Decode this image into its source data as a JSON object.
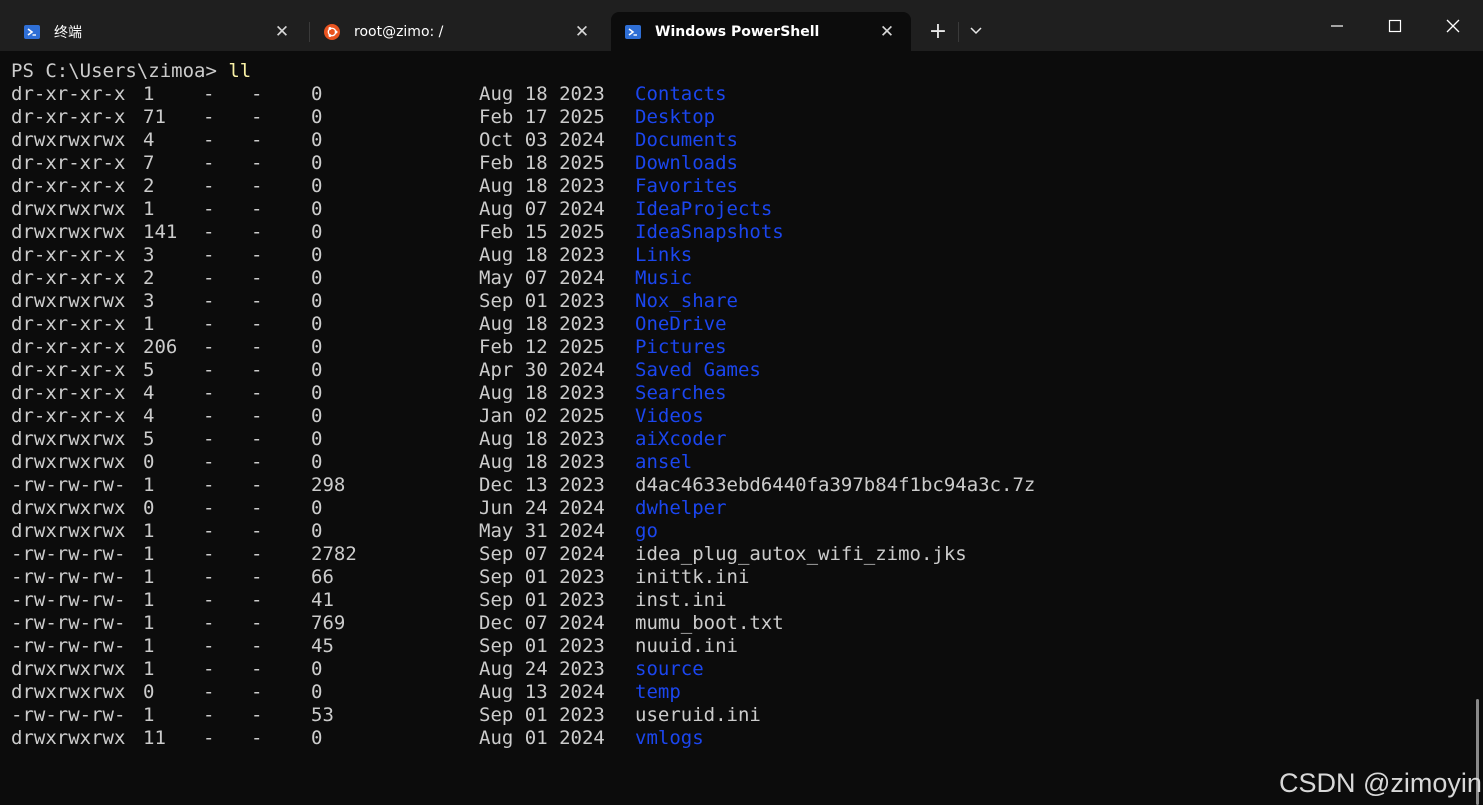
{
  "tabs": [
    {
      "title": "终端",
      "icon": "powershell-icon",
      "active": false
    },
    {
      "title": "root@zimo: /",
      "icon": "ubuntu-icon",
      "active": false
    },
    {
      "title": "Windows PowerShell",
      "icon": "powershell-icon",
      "active": true
    }
  ],
  "colors": {
    "background": "#0c0c0c",
    "titlebar": "#1f1f1f",
    "text": "#cccccc",
    "command": "#f9f1a5",
    "directory": "#1b46ef",
    "powershell_blue": "#2f6fd6",
    "ubuntu_orange": "#e95420"
  },
  "prompt": {
    "text": "PS C:\\Users\\zimoa> ",
    "command": "ll"
  },
  "listing": [
    {
      "mode": "dr-xr-xr-x",
      "links": "1",
      "owner": "-",
      "group": "-",
      "size": "0",
      "date": "Aug 18 2023",
      "name": "Contacts",
      "type": "dir"
    },
    {
      "mode": "dr-xr-xr-x",
      "links": "71",
      "owner": "-",
      "group": "-",
      "size": "0",
      "date": "Feb 17 2025",
      "name": "Desktop",
      "type": "dir"
    },
    {
      "mode": "drwxrwxrwx",
      "links": "4",
      "owner": "-",
      "group": "-",
      "size": "0",
      "date": "Oct 03 2024",
      "name": "Documents",
      "type": "dir"
    },
    {
      "mode": "dr-xr-xr-x",
      "links": "7",
      "owner": "-",
      "group": "-",
      "size": "0",
      "date": "Feb 18 2025",
      "name": "Downloads",
      "type": "dir"
    },
    {
      "mode": "dr-xr-xr-x",
      "links": "2",
      "owner": "-",
      "group": "-",
      "size": "0",
      "date": "Aug 18 2023",
      "name": "Favorites",
      "type": "dir"
    },
    {
      "mode": "drwxrwxrwx",
      "links": "1",
      "owner": "-",
      "group": "-",
      "size": "0",
      "date": "Aug 07 2024",
      "name": "IdeaProjects",
      "type": "dir"
    },
    {
      "mode": "drwxrwxrwx",
      "links": "141",
      "owner": "-",
      "group": "-",
      "size": "0",
      "date": "Feb 15 2025",
      "name": "IdeaSnapshots",
      "type": "dir"
    },
    {
      "mode": "dr-xr-xr-x",
      "links": "3",
      "owner": "-",
      "group": "-",
      "size": "0",
      "date": "Aug 18 2023",
      "name": "Links",
      "type": "dir"
    },
    {
      "mode": "dr-xr-xr-x",
      "links": "2",
      "owner": "-",
      "group": "-",
      "size": "0",
      "date": "May 07 2024",
      "name": "Music",
      "type": "dir"
    },
    {
      "mode": "drwxrwxrwx",
      "links": "3",
      "owner": "-",
      "group": "-",
      "size": "0",
      "date": "Sep 01 2023",
      "name": "Nox_share",
      "type": "dir"
    },
    {
      "mode": "dr-xr-xr-x",
      "links": "1",
      "owner": "-",
      "group": "-",
      "size": "0",
      "date": "Aug 18 2023",
      "name": "OneDrive",
      "type": "dir"
    },
    {
      "mode": "dr-xr-xr-x",
      "links": "206",
      "owner": "-",
      "group": "-",
      "size": "0",
      "date": "Feb 12 2025",
      "name": "Pictures",
      "type": "dir"
    },
    {
      "mode": "dr-xr-xr-x",
      "links": "5",
      "owner": "-",
      "group": "-",
      "size": "0",
      "date": "Apr 30 2024",
      "name": "Saved Games",
      "type": "dir"
    },
    {
      "mode": "dr-xr-xr-x",
      "links": "4",
      "owner": "-",
      "group": "-",
      "size": "0",
      "date": "Aug 18 2023",
      "name": "Searches",
      "type": "dir"
    },
    {
      "mode": "dr-xr-xr-x",
      "links": "4",
      "owner": "-",
      "group": "-",
      "size": "0",
      "date": "Jan 02 2025",
      "name": "Videos",
      "type": "dir"
    },
    {
      "mode": "drwxrwxrwx",
      "links": "5",
      "owner": "-",
      "group": "-",
      "size": "0",
      "date": "Aug 18 2023",
      "name": "aiXcoder",
      "type": "dir"
    },
    {
      "mode": "drwxrwxrwx",
      "links": "0",
      "owner": "-",
      "group": "-",
      "size": "0",
      "date": "Aug 18 2023",
      "name": "ansel",
      "type": "dir"
    },
    {
      "mode": "-rw-rw-rw-",
      "links": "1",
      "owner": "-",
      "group": "-",
      "size": "298",
      "date": "Dec 13 2023",
      "name": "d4ac4633ebd6440fa397b84f1bc94a3c.7z",
      "type": "file"
    },
    {
      "mode": "drwxrwxrwx",
      "links": "0",
      "owner": "-",
      "group": "-",
      "size": "0",
      "date": "Jun 24 2024",
      "name": "dwhelper",
      "type": "dir"
    },
    {
      "mode": "drwxrwxrwx",
      "links": "1",
      "owner": "-",
      "group": "-",
      "size": "0",
      "date": "May 31 2024",
      "name": "go",
      "type": "dir"
    },
    {
      "mode": "-rw-rw-rw-",
      "links": "1",
      "owner": "-",
      "group": "-",
      "size": "2782",
      "date": "Sep 07 2024",
      "name": "idea_plug_autox_wifi_zimo.jks",
      "type": "file"
    },
    {
      "mode": "-rw-rw-rw-",
      "links": "1",
      "owner": "-",
      "group": "-",
      "size": "66",
      "date": "Sep 01 2023",
      "name": "inittk.ini",
      "type": "file"
    },
    {
      "mode": "-rw-rw-rw-",
      "links": "1",
      "owner": "-",
      "group": "-",
      "size": "41",
      "date": "Sep 01 2023",
      "name": "inst.ini",
      "type": "file"
    },
    {
      "mode": "-rw-rw-rw-",
      "links": "1",
      "owner": "-",
      "group": "-",
      "size": "769",
      "date": "Dec 07 2024",
      "name": "mumu_boot.txt",
      "type": "file"
    },
    {
      "mode": "-rw-rw-rw-",
      "links": "1",
      "owner": "-",
      "group": "-",
      "size": "45",
      "date": "Sep 01 2023",
      "name": "nuuid.ini",
      "type": "file"
    },
    {
      "mode": "drwxrwxrwx",
      "links": "1",
      "owner": "-",
      "group": "-",
      "size": "0",
      "date": "Aug 24 2023",
      "name": "source",
      "type": "dir"
    },
    {
      "mode": "drwxrwxrwx",
      "links": "0",
      "owner": "-",
      "group": "-",
      "size": "0",
      "date": "Aug 13 2024",
      "name": "temp",
      "type": "dir"
    },
    {
      "mode": "-rw-rw-rw-",
      "links": "1",
      "owner": "-",
      "group": "-",
      "size": "53",
      "date": "Sep 01 2023",
      "name": "useruid.ini",
      "type": "file"
    },
    {
      "mode": "drwxrwxrwx",
      "links": "11",
      "owner": "-",
      "group": "-",
      "size": "0",
      "date": "Aug 01 2024",
      "name": "vmlogs",
      "type": "dir"
    }
  ],
  "watermark": "CSDN @zimoyin"
}
